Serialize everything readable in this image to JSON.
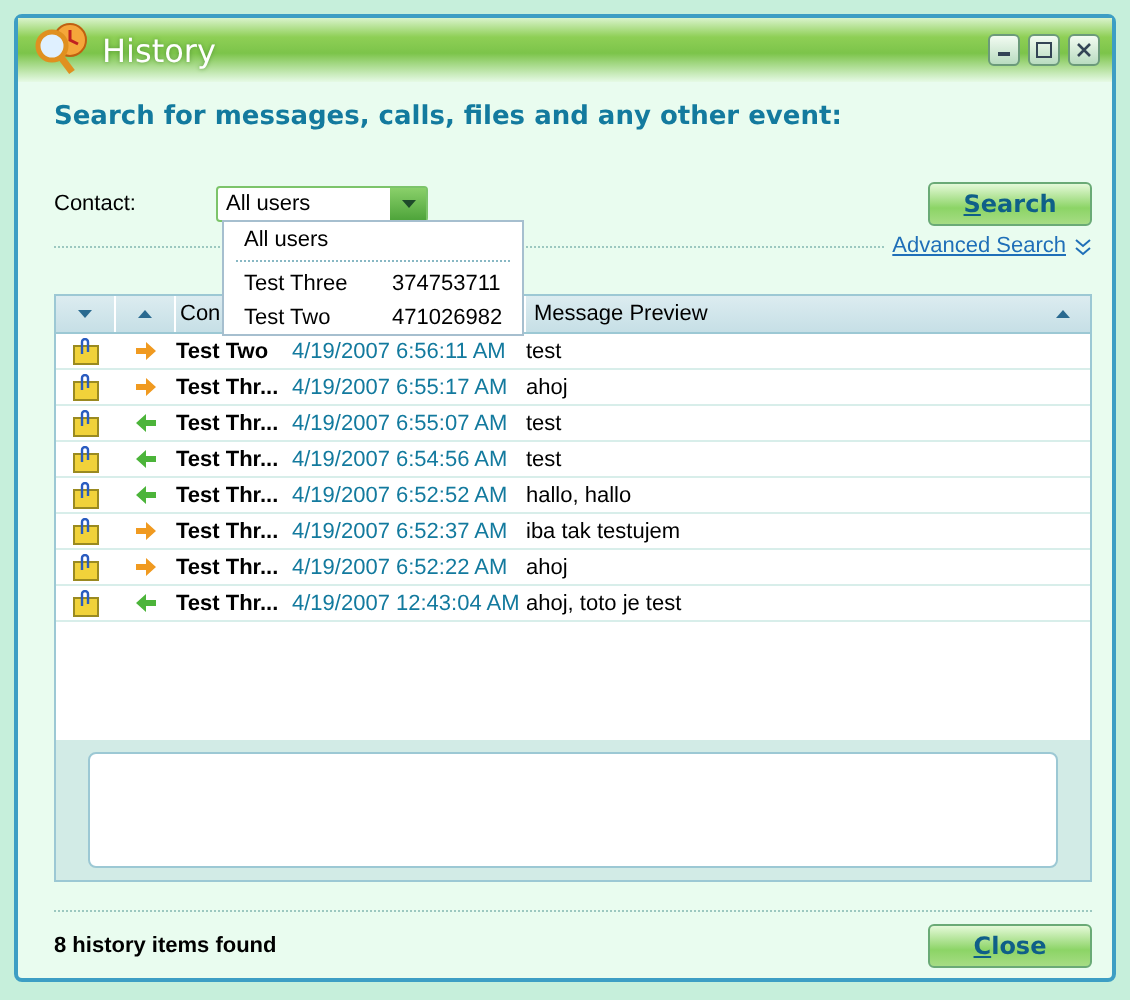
{
  "window": {
    "title": "History"
  },
  "heading": "Search for messages, calls, files and any other event:",
  "contact": {
    "label": "Contact:",
    "value": "All users",
    "expanded": true
  },
  "contact_dropdown": [
    {
      "name": "All users"
    },
    {
      "name": "Test Three",
      "number": "374753711"
    },
    {
      "name": "Test Two",
      "number": "471026982"
    }
  ],
  "search_button": "Search",
  "advanced_search": "Advanced Search",
  "table": {
    "header": {
      "contact": "Con",
      "preview": "Message Preview"
    },
    "rows": [
      {
        "kind": "outgoing",
        "contact": "Test Two",
        "time": "4/19/2007 6:56:11 AM",
        "preview": "test"
      },
      {
        "kind": "outgoing",
        "contact": "Test Thr...",
        "time": "4/19/2007 6:55:17 AM",
        "preview": "ahoj"
      },
      {
        "kind": "incoming",
        "contact": "Test Thr...",
        "time": "4/19/2007 6:55:07 AM",
        "preview": "test"
      },
      {
        "kind": "incoming",
        "contact": "Test Thr...",
        "time": "4/19/2007 6:54:56 AM",
        "preview": "test"
      },
      {
        "kind": "incoming",
        "contact": "Test Thr...",
        "time": "4/19/2007 6:52:52 AM",
        "preview": "hallo, hallo"
      },
      {
        "kind": "outgoing",
        "contact": "Test Thr...",
        "time": "4/19/2007 6:52:37 AM",
        "preview": "iba tak testujem"
      },
      {
        "kind": "outgoing",
        "contact": "Test Thr...",
        "time": "4/19/2007 6:52:22 AM",
        "preview": "ahoj"
      },
      {
        "kind": "incoming",
        "contact": "Test Thr...",
        "time": "4/19/2007 12:43:04 AM",
        "preview": "ahoj, toto je test"
      }
    ]
  },
  "status": "8 history items found",
  "close_button": "Close"
}
